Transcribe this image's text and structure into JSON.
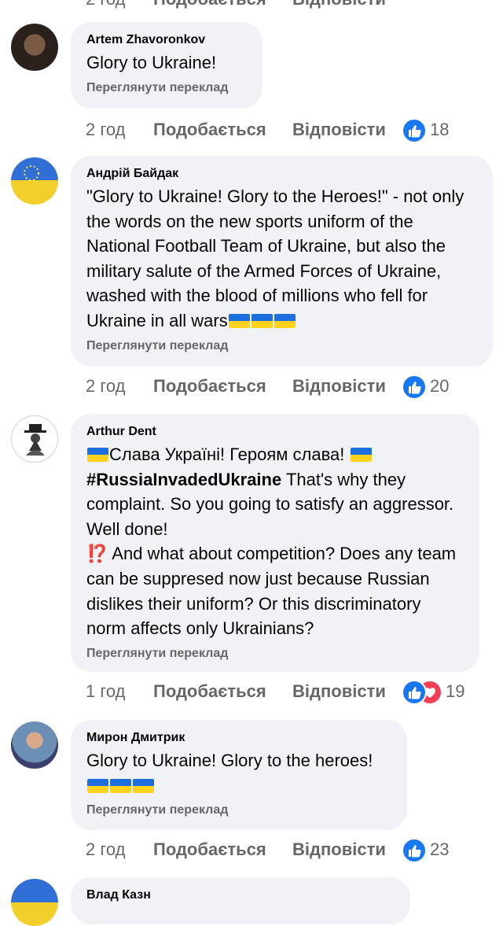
{
  "colors": {
    "bubble": "#f0f2f5",
    "meta": "#65676b",
    "like_blue": "#1877f2",
    "heart_red": "#f33e58",
    "flag_blue": "#1d6fe0",
    "flag_yellow": "#ffd21e"
  },
  "labels": {
    "translate": "Переглянути переклад",
    "like": "Подобається",
    "reply": "Відповісти"
  },
  "comments": [
    {
      "author": "Artem Zhavoronkov",
      "text": "Glory to Ukraine!",
      "time": "2 год",
      "reactions": [
        "like"
      ],
      "count": "18"
    },
    {
      "author": "Андрій Байдак",
      "text": "\"Glory to Ukraine! Glory to the Heroes!\" - not only the words on the new sports uniform of the National Football Team of Ukraine, but also the military salute of the Armed Forces of Ukraine, washed with the blood of millions who fell for Ukraine in all wars",
      "flags": 3,
      "time": "2 год",
      "reactions": [
        "like"
      ],
      "count": "20"
    },
    {
      "author": "Arthur Dent",
      "line1": "Слава Україні! Героям слава!",
      "hashtag": "#RussiaInvadedUkraine",
      "text_after_hashtag": " That's why they complaint. So you going to satisfy an aggressor. Well done!",
      "interrobang": "⁉️",
      "text2": " And what about competition? Does any team can be suppresed now just because Russian dislikes their uniform? Or this discriminatory norm affects only Ukrainians?",
      "time": "1 год",
      "reactions": [
        "like",
        "love"
      ],
      "count": "19"
    },
    {
      "author": "Мирон Дмитрик",
      "text": "Glory to Ukraine! Glory to the heroes!",
      "flags": 3,
      "time": "2 год",
      "reactions": [
        "like"
      ],
      "count": "23"
    },
    {
      "author": "Влад Казн"
    }
  ]
}
